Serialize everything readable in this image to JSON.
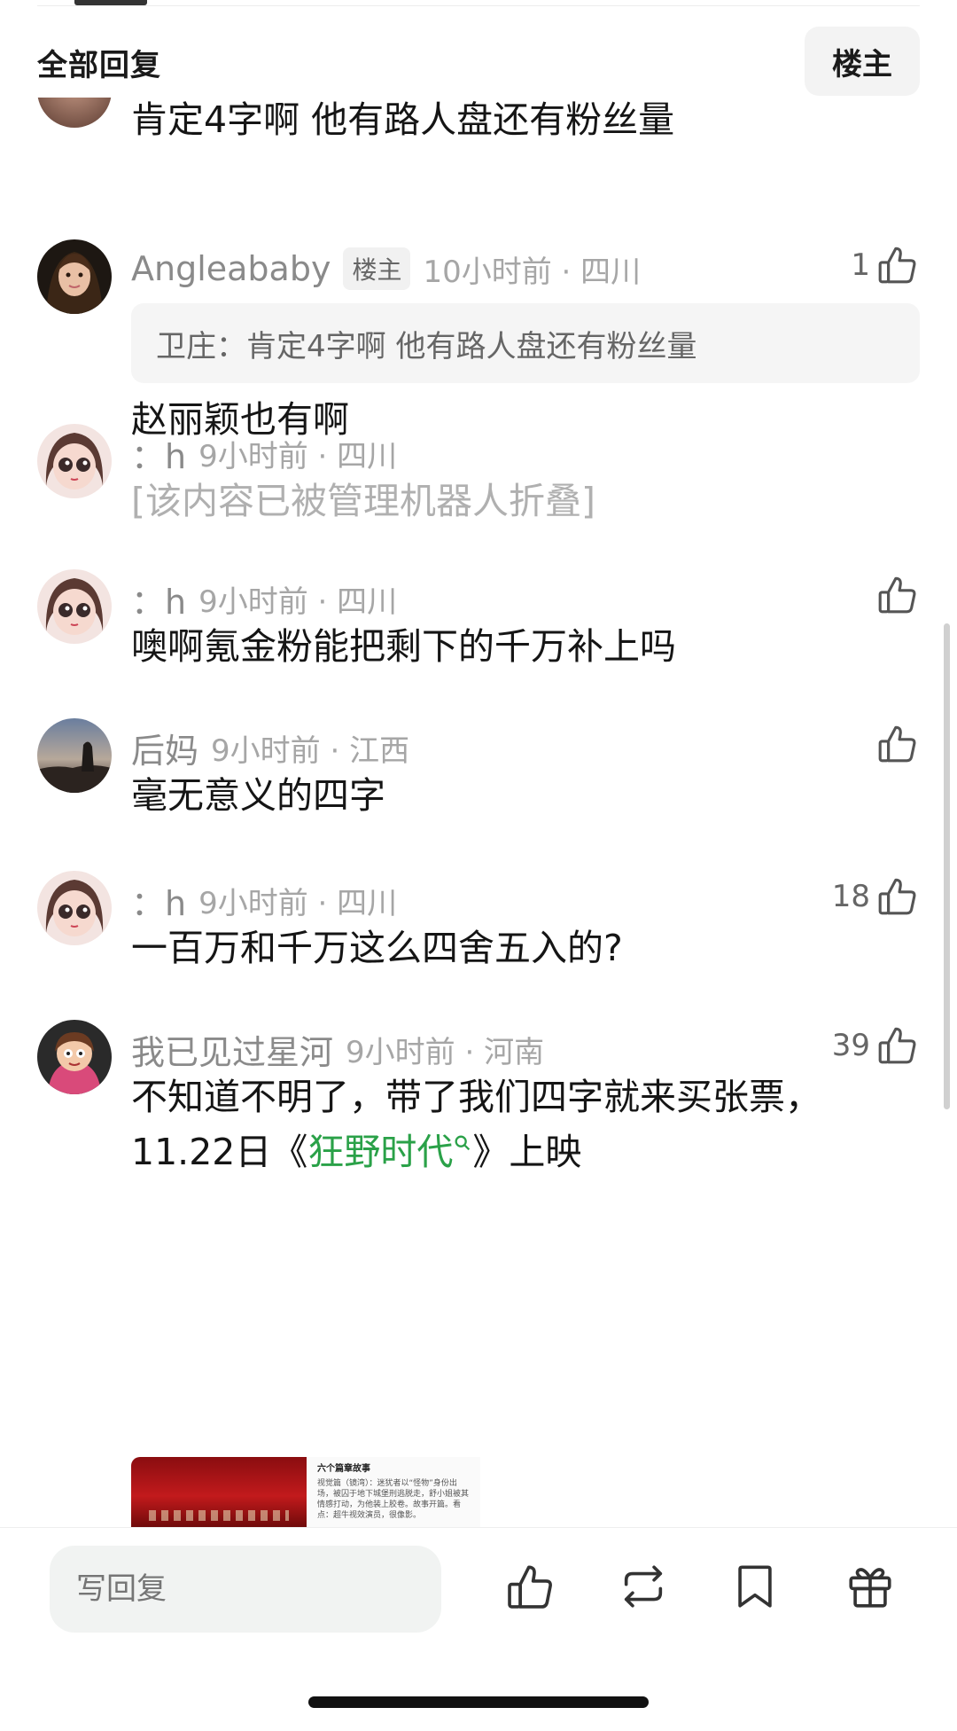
{
  "header": {
    "title": "全部回复",
    "owner_toggle": "楼主"
  },
  "comments": [
    {
      "text": "肯定4字啊 他有路人盘还有粉丝量"
    },
    {
      "user": "Angleababy",
      "badge": "楼主",
      "time_loc": "10小时前 · 四川",
      "likes": "1",
      "quote": "卫庄：肯定4字啊 他有路人盘还有粉丝量",
      "text": "赵丽颖也有啊"
    },
    {
      "user": "：h",
      "time_loc": "9小时前 · 四川",
      "folded_text": "[该内容已被管理机器人折叠]"
    },
    {
      "user": "：h",
      "time_loc": "9小时前 · 四川",
      "likes": "",
      "text": "噢啊氪金粉能把剩下的千万补上吗"
    },
    {
      "user": "后妈",
      "time_loc": "9小时前 · 江西",
      "likes": "",
      "text": "毫无意义的四字"
    },
    {
      "user": "：h",
      "time_loc": "9小时前 · 四川",
      "likes": "18",
      "text": "一百万和千万这么四舍五入的?"
    },
    {
      "user": "我已见过星河",
      "time_loc": "9小时前 · 河南",
      "likes": "39",
      "text_line1": "不知道不明了，带了我们四字就来买张票，",
      "text_line2_pre": "11.22日《",
      "movie_link": "狂野时代",
      "text_line2_post": "》上映",
      "thumb_title": "六个篇章故事",
      "thumb_body": "视觉篇（镜湾）：迷犹者以“怪物”身份出场，被囚于地下城堡刑逃脱走，舒小姐被其情感打动，为他装上胶卷。故事开篇。看点：超牛视效演员，很像影。"
    }
  ],
  "bottom_bar": {
    "reply_placeholder": "写回复",
    "icons": [
      "thumbs-up-icon",
      "repost-icon",
      "bookmark-icon",
      "gift-icon"
    ]
  }
}
